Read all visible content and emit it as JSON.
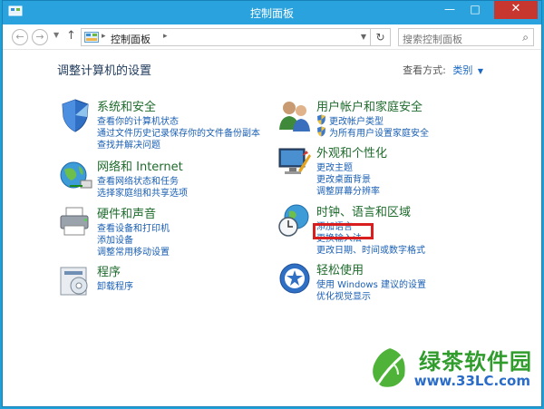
{
  "window": {
    "title": "控制面板"
  },
  "nav": {
    "address_root": "控制面板",
    "search_placeholder": "搜索控制面板"
  },
  "main": {
    "heading": "调整计算机的设置",
    "view_by_label": "查看方式:",
    "view_by_value": "类别"
  },
  "categories": [
    {
      "title": "系统和安全",
      "links": [
        "查看你的计算机状态",
        "通过文件历史记录保存你的文件备份副本",
        "查找并解决问题"
      ]
    },
    {
      "title": "网络和 Internet",
      "links": [
        "查看网络状态和任务",
        "选择家庭组和共享选项"
      ]
    },
    {
      "title": "硬件和声音",
      "links": [
        "查看设备和打印机",
        "添加设备",
        "调整常用移动设置"
      ]
    },
    {
      "title": "程序",
      "links": [
        "卸载程序"
      ]
    },
    {
      "title": "用户帐户和家庭安全",
      "links": [
        "更改帐户类型",
        "为所有用户设置家庭安全"
      ]
    },
    {
      "title": "外观和个性化",
      "links": [
        "更改主题",
        "更改桌面背景",
        "调整屏幕分辨率"
      ]
    },
    {
      "title": "时钟、语言和区域",
      "links": [
        "添加语言",
        "更换输入法",
        "更改日期、时间或数字格式"
      ]
    },
    {
      "title": "轻松使用",
      "links": [
        "使用 Windows 建议的设置",
        "优化视觉显示"
      ]
    }
  ],
  "watermark": {
    "brand": "绿茶软件园",
    "url": "www.33LC.com"
  },
  "icons": {
    "shield": "shield-icon",
    "network": "globe-icon",
    "hardware": "printer-icon",
    "programs": "programs-icon",
    "users": "users-icon",
    "appearance": "monitor-icon",
    "clock": "clock-globe-icon",
    "ease": "ease-of-access-icon"
  },
  "colors": {
    "titlebar": "#2aa2dd",
    "heading": "#1e6b2c",
    "link": "#1a5fb4",
    "highlight": "#d81e1e"
  }
}
